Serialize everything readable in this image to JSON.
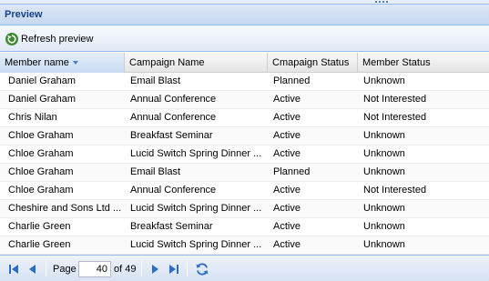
{
  "panel": {
    "title": "Preview"
  },
  "toolbar": {
    "refresh_label": "Refresh preview"
  },
  "grid": {
    "columns": [
      "Member name",
      "Campaign Name",
      "Cmapaign Status",
      "Member Status"
    ],
    "rows": [
      [
        "Daniel Graham",
        "Email Blast",
        "Planned",
        "Unknown"
      ],
      [
        "Daniel Graham",
        "Annual Conference",
        "Active",
        "Not Interested"
      ],
      [
        "Chris Nilan",
        "Annual Conference",
        "Active",
        "Not Interested"
      ],
      [
        "Chloe Graham",
        "Breakfast Seminar",
        "Active",
        "Unknown"
      ],
      [
        "Chloe Graham",
        "Lucid Switch Spring Dinner ...",
        "Active",
        "Unknown"
      ],
      [
        "Chloe Graham",
        "Email Blast",
        "Planned",
        "Unknown"
      ],
      [
        "Chloe Graham",
        "Annual Conference",
        "Active",
        "Not Interested"
      ],
      [
        "Cheshire and Sons Ltd ...",
        "Lucid Switch Spring Dinner ...",
        "Active",
        "Unknown"
      ],
      [
        "Charlie Green",
        "Breakfast Seminar",
        "Active",
        "Unknown"
      ],
      [
        "Charlie Green",
        "Lucid Switch Spring Dinner ...",
        "Active",
        "Unknown"
      ]
    ]
  },
  "pager": {
    "page_label": "Page",
    "current_page": "40",
    "of_label": "of 49"
  },
  "colors": {
    "header_text": "#15428b",
    "border": "#99bbe8",
    "pager_icon": "#2b6cc4",
    "refresh_green": "#3d8a33"
  }
}
